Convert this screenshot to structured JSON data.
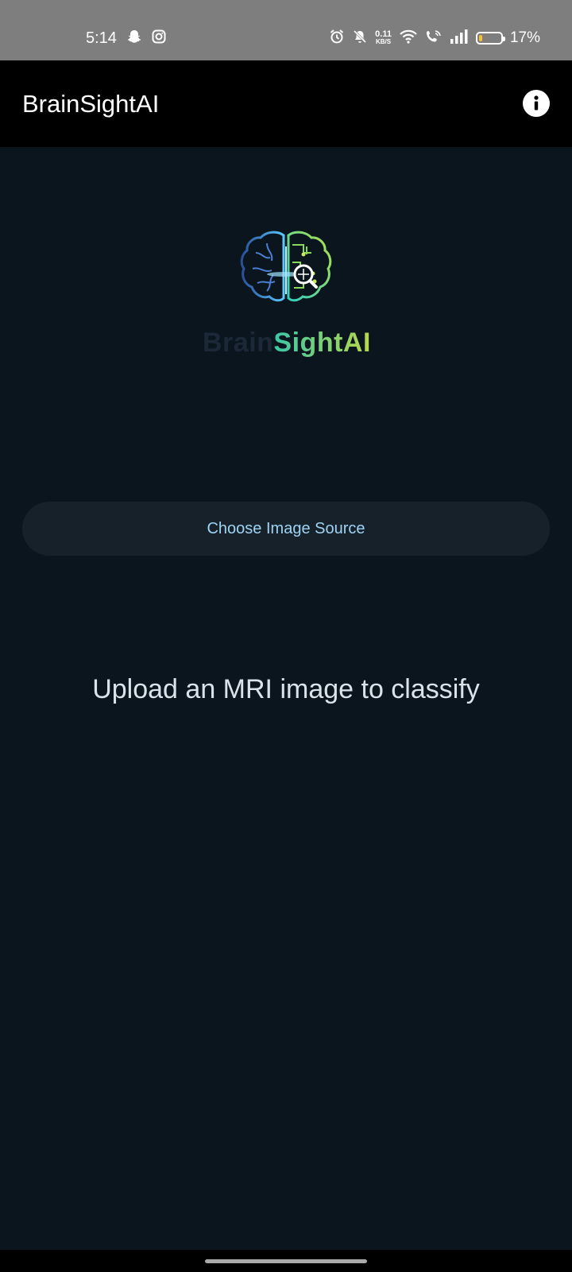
{
  "status_bar": {
    "time": "5:14",
    "net_speed_value": "0.11",
    "net_speed_unit": "KB/S",
    "battery_percent": "17%",
    "battery_level": 0.17,
    "icons": [
      "snapchat-icon",
      "instagram-icon",
      "alarm-icon",
      "bell-off-icon",
      "wifi-icon",
      "wifi-calling-icon",
      "signal-icon",
      "battery-icon"
    ]
  },
  "app_bar": {
    "title": "BrainSightAI",
    "info_icon": "info-icon"
  },
  "logo": {
    "text_part1": "Brain",
    "text_part2": "SightAI"
  },
  "main": {
    "choose_button_label": "Choose Image Source",
    "upload_prompt": "Upload an MRI image to classify"
  },
  "colors": {
    "background": "#0b151d",
    "app_bar": "#000000",
    "button_bg": "#17212a",
    "button_text": "#9ed3f4",
    "status_bar": "#7e7e7e"
  }
}
